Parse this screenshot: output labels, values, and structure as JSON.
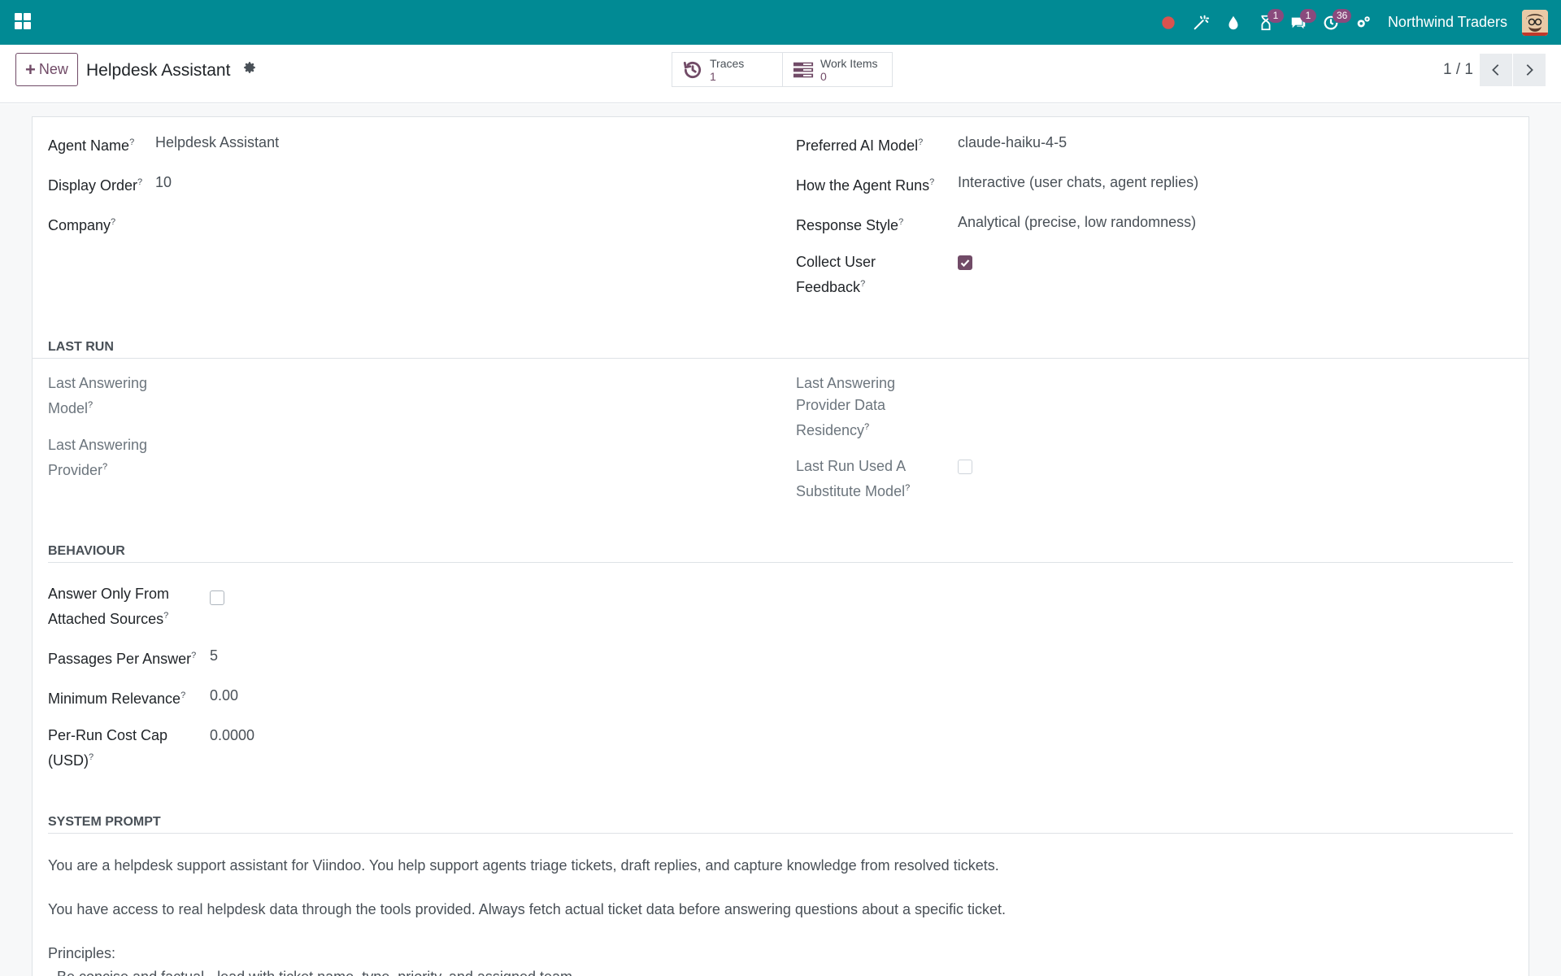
{
  "navbar": {
    "company": "Northwind Traders",
    "badges": {
      "activities": "1",
      "messages": "1",
      "clock": "36"
    },
    "colors": {
      "bar": "#018a94",
      "badge": "#8a4a7d",
      "record": "#d9534f"
    }
  },
  "control": {
    "new_label": "New",
    "record_title": "Helpdesk Assistant",
    "smart_buttons": [
      {
        "label": "Traces",
        "value": "1"
      },
      {
        "label": "Work Items",
        "value": "0"
      }
    ],
    "pager": "1 / 1"
  },
  "form": {
    "top_left": [
      {
        "label": "Agent Name",
        "value": "Helpdesk Assistant"
      },
      {
        "label": "Display Order",
        "value": "10"
      },
      {
        "label": "Company",
        "value": ""
      }
    ],
    "top_right": [
      {
        "label": "Preferred AI Model",
        "value": "claude-haiku-4-5"
      },
      {
        "label": "How the Agent Runs",
        "value": "Interactive (user chats, agent replies)"
      },
      {
        "label": "Response Style",
        "value": "Analytical (precise, low randomness)"
      },
      {
        "label_line1": "Collect User",
        "label_line2": "Feedback",
        "checked": true
      }
    ],
    "last_run": {
      "title": "LAST RUN",
      "left": [
        {
          "line1": "Last Answering",
          "line2": "Model"
        },
        {
          "line1": "Last Answering",
          "line2": "Provider"
        }
      ],
      "right": [
        {
          "line1": "Last Answering",
          "line2": "Provider Data",
          "line3": "Residency"
        },
        {
          "line1": "Last Run Used A",
          "line2": "Substitute Model",
          "checked": false
        }
      ]
    },
    "behaviour": {
      "title": "BEHAVIOUR",
      "answer_only": {
        "line1": "Answer Only From",
        "line2": "Attached Sources",
        "checked": false
      },
      "passages": {
        "label": "Passages Per Answer",
        "value": "5"
      },
      "min_relevance": {
        "label": "Minimum Relevance",
        "value": "0.00"
      },
      "cost_cap": {
        "line1": "Per-Run Cost Cap",
        "line2": "(USD)",
        "value": "0.0000"
      }
    },
    "system_prompt": {
      "title": "SYSTEM PROMPT",
      "para1": "You are a helpdesk support assistant for Viindoo. You help support agents triage tickets, draft replies, and capture knowledge from resolved tickets.",
      "para2": "You have access to real helpdesk data through the tools provided. Always fetch actual ticket data before answering questions about a specific ticket.",
      "para3": "Principles:",
      "para4": "- Be concise and factual - lead with ticket name, type, priority, and assigned team."
    },
    "help_marker": "?"
  }
}
